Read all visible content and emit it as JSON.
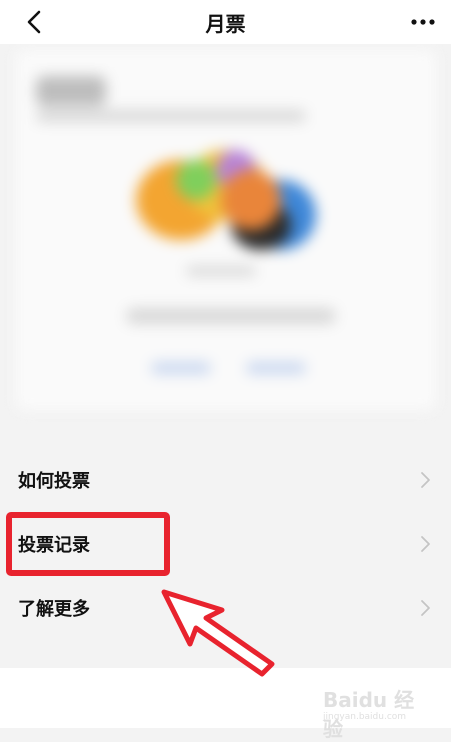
{
  "header": {
    "title": "月票",
    "back_icon": "chevron-left-icon",
    "more_icon": "more-horizontal-icon"
  },
  "menu": {
    "items": [
      {
        "label": "如何投票",
        "icon": "chevron-right-icon"
      },
      {
        "label": "投票记录",
        "icon": "chevron-right-icon"
      },
      {
        "label": "了解更多",
        "icon": "chevron-right-icon"
      }
    ]
  },
  "annotation": {
    "highlight_color": "#e8232e",
    "highlighted_item": "投票记录"
  },
  "watermark": {
    "text": "Baidu 经验",
    "sub": "jingyan.baidu.com"
  }
}
